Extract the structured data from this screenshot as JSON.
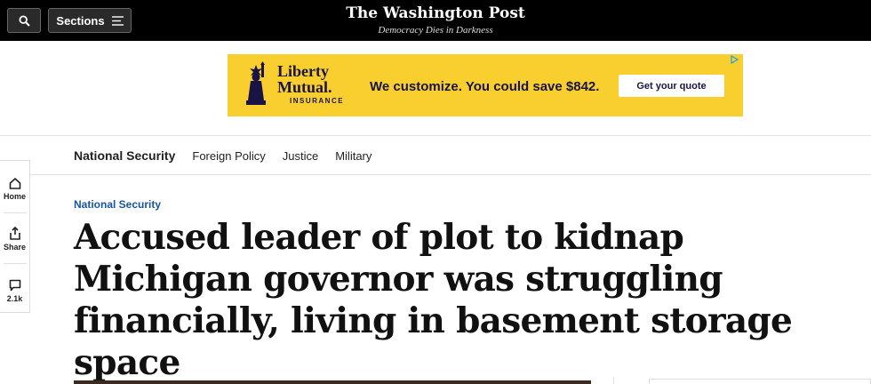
{
  "header": {
    "sections_label": "Sections",
    "logo_text": "The Washington Post",
    "tagline": "Democracy Dies in Darkness"
  },
  "ad": {
    "brand_line1": "Liberty",
    "brand_line2": "Mutual.",
    "brand_line3": "INSURANCE",
    "copy": "We customize. You could save $842.",
    "cta": "Get your quote",
    "brand_color": "#1a1446",
    "background_color": "#f8cf2f"
  },
  "subnav": {
    "title": "National Security",
    "items": [
      "Foreign Policy",
      "Justice",
      "Military"
    ]
  },
  "left_rail": {
    "home_label": "Home",
    "share_label": "Share",
    "comments_count": "2.1k"
  },
  "article": {
    "kicker": "National Security",
    "kicker_color": "#1955a5",
    "headline": "Accused leader of plot to kidnap Michigan governor was struggling financially, living in basement storage space"
  }
}
